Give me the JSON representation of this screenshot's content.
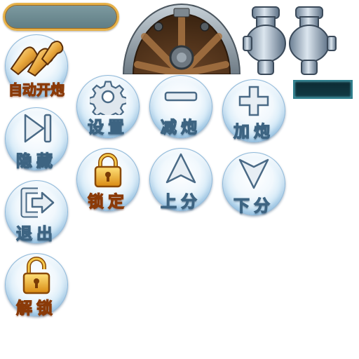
{
  "buttons": {
    "auto_fire": "自动开炮",
    "settings": "设置",
    "decrease_cannon": "减炮",
    "increase_cannon": "加炮",
    "hide": "隐藏",
    "lock": "锁定",
    "score_up": "上分",
    "score_down": "下分",
    "exit": "退出",
    "unlock": "解锁"
  },
  "colors": {
    "label_text": "#ffffff",
    "label_outline": "#3d6482",
    "gold_text": "#ffd24a",
    "gold_outline": "#8a3a08",
    "bubble_edge": "#98c3e3"
  },
  "icons": {
    "auto_fire": "shells-icon",
    "settings": "gear-icon",
    "decrease_cannon": "minus-icon",
    "increase_cannon": "plus-icon",
    "hide": "skip-forward-icon",
    "lock": "padlock-closed-icon",
    "score_up": "arrow-up-icon",
    "score_down": "arrow-down-icon",
    "exit": "exit-icon",
    "unlock": "padlock-open-icon"
  }
}
